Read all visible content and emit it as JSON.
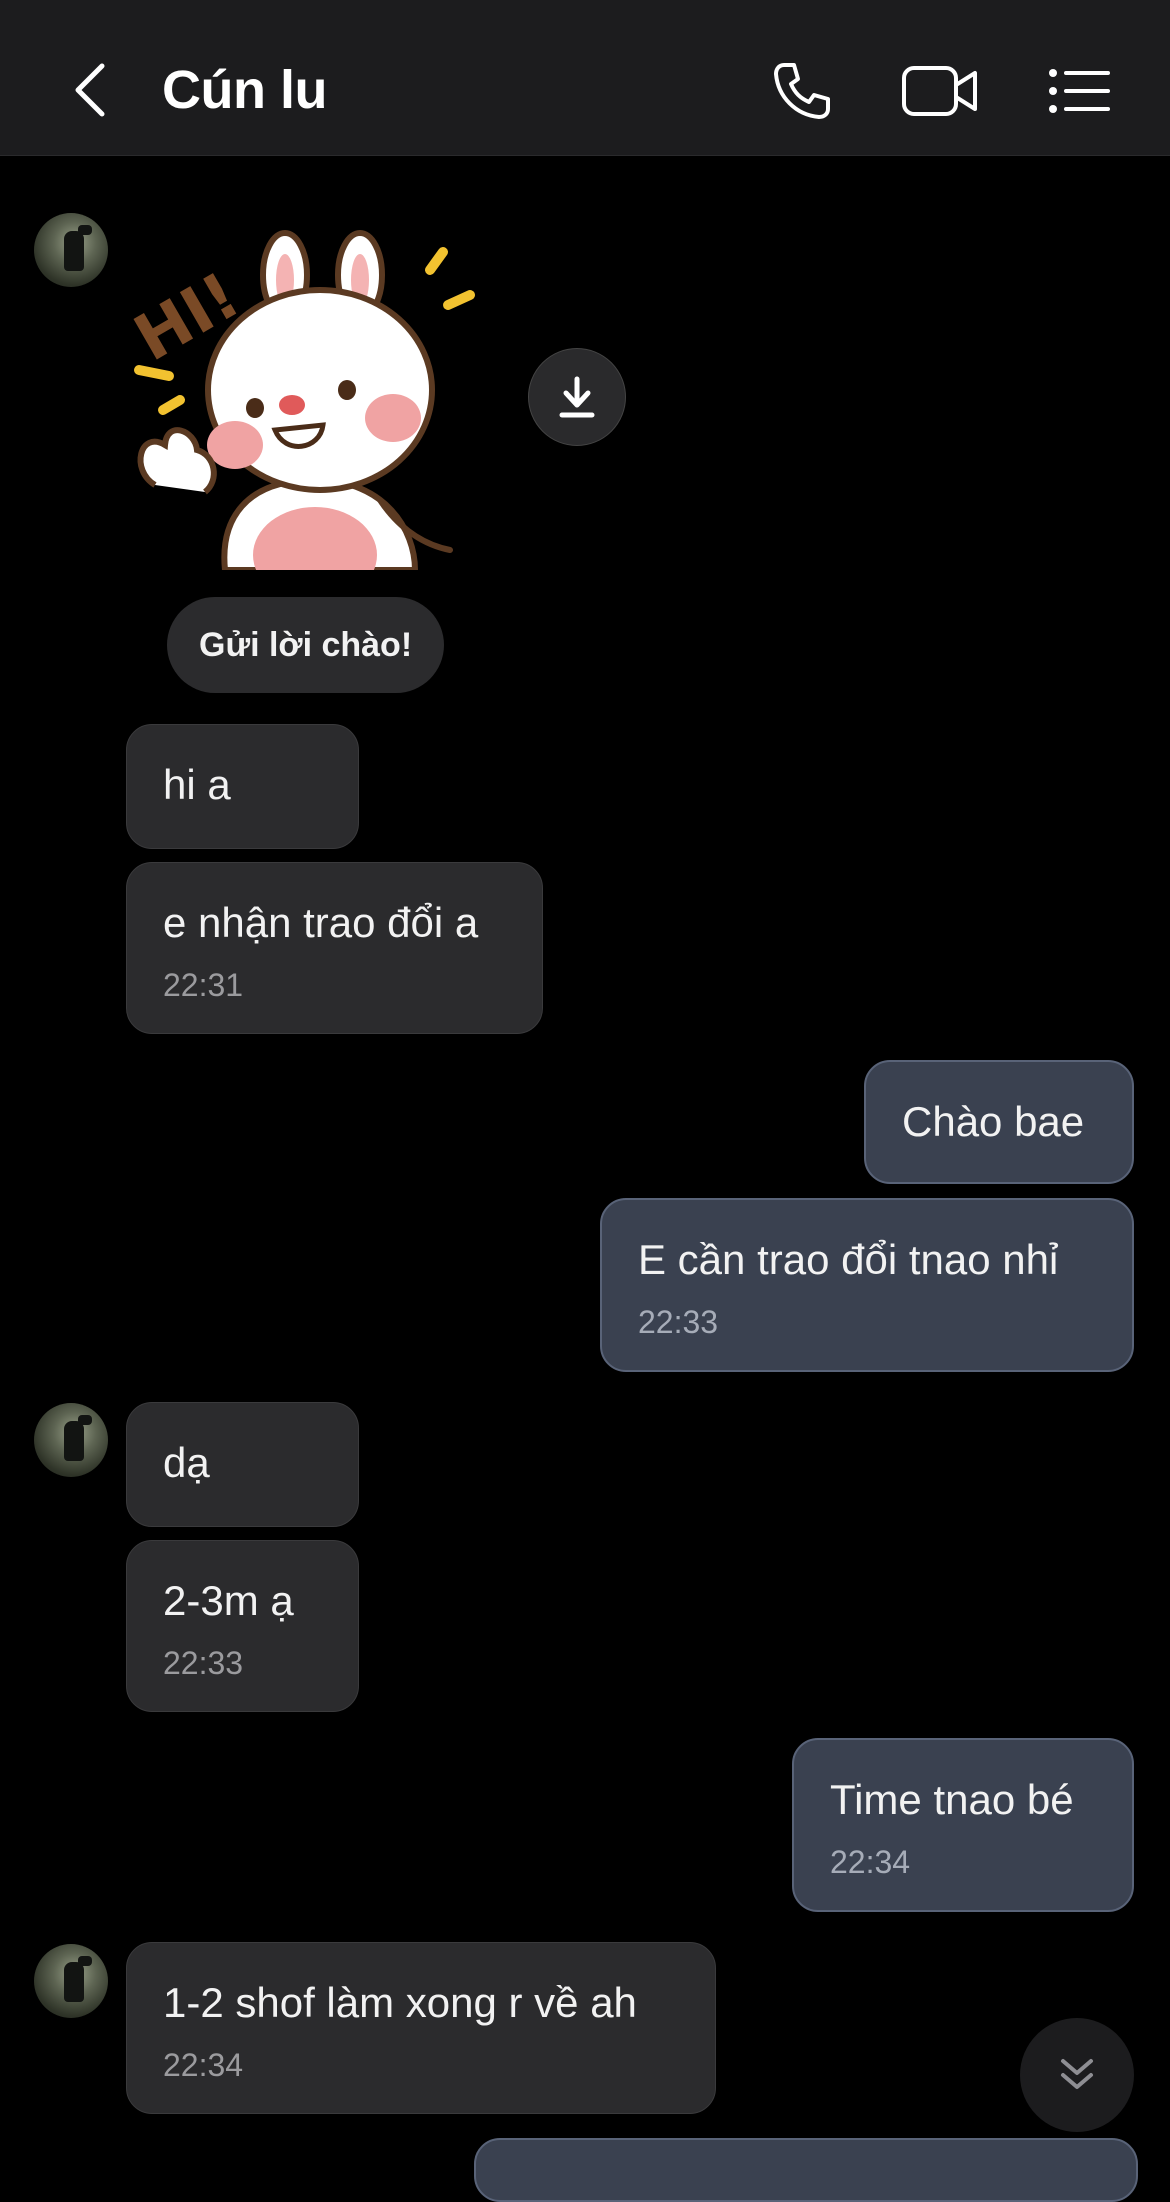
{
  "header": {
    "title": "Cún lu",
    "icons": [
      "back-arrow-icon",
      "phone-icon",
      "video-camera-icon",
      "menu-list-icon"
    ]
  },
  "sticker": {
    "text": "HI!",
    "caption": "Gửi lời chào!"
  },
  "messages": [
    {
      "side": "in",
      "text": "hi a"
    },
    {
      "side": "in",
      "text": "e nhận trao đổi a",
      "time": "22:31"
    },
    {
      "side": "out",
      "text": "Chào bae"
    },
    {
      "side": "out",
      "text": "E cần trao đổi tnao nhỉ",
      "time": "22:33"
    },
    {
      "side": "in",
      "text": "dạ"
    },
    {
      "side": "in",
      "text": "2-3m ạ",
      "time": "22:33"
    },
    {
      "side": "out",
      "text": "Time tnao bé",
      "time": "22:34"
    },
    {
      "side": "in",
      "text": "1-2 shof làm xong r về ah",
      "time": "22:34"
    }
  ],
  "colors": {
    "background": "#000000",
    "header": "#1c1c1e",
    "incoming_bubble": "#2b2b2d",
    "outgoing_bubble": "#3a4150"
  }
}
